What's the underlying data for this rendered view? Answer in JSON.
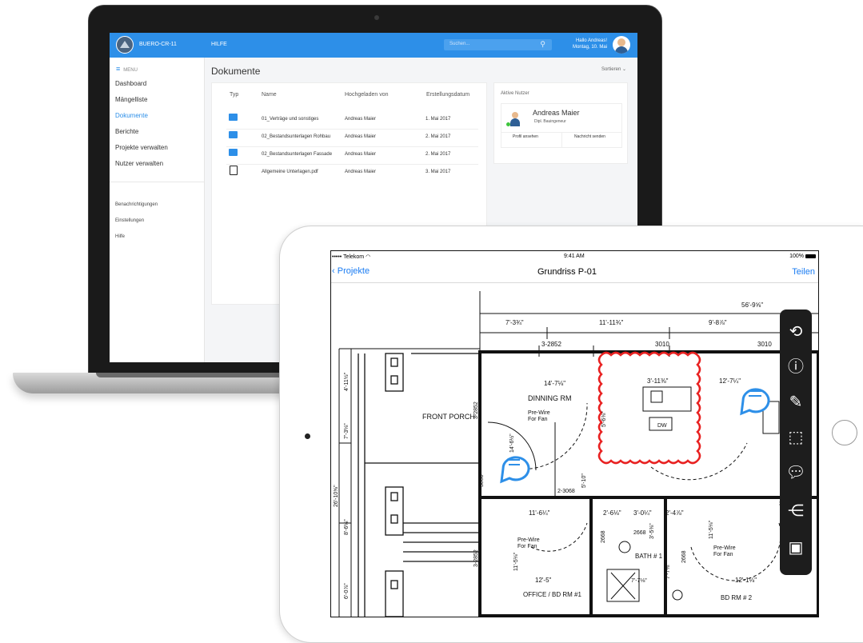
{
  "laptop": {
    "app_name": "BUERO-CR-11",
    "help_label": "HILFE",
    "search_placeholder": "Suchen...",
    "greeting": "Hallo Andreas!",
    "date": "Montag, 10. Mai",
    "menu_label": "MENU",
    "nav": [
      {
        "label": "Dashboard"
      },
      {
        "label": "Mängelliste"
      },
      {
        "label": "Dokumente",
        "active": true
      },
      {
        "label": "Berichte"
      },
      {
        "label": "Projekte verwalten"
      },
      {
        "label": "Nutzer verwalten"
      }
    ],
    "nav_secondary": [
      {
        "label": "Benachrichtigungen"
      },
      {
        "label": "Einstellungen"
      },
      {
        "label": "Hilfe"
      }
    ],
    "page_title": "Dokumente",
    "sort_label": "Sortieren",
    "table": {
      "headers": [
        "Typ",
        "Name",
        "Hochgeladen von",
        "Erstellungsdatum"
      ],
      "rows": [
        {
          "type": "folder",
          "name": "01_Verträge und sonstiges",
          "uploader": "Andreas Maier",
          "date": "1. Mai 2017"
        },
        {
          "type": "folder",
          "name": "02_Bestandsunterlagen Rohbau",
          "uploader": "Andreas Maier",
          "date": "2. Mai 2017"
        },
        {
          "type": "folder",
          "name": "02_Bestandsunterlagen Fassade",
          "uploader": "Andreas Maier",
          "date": "2. Mai 2017"
        },
        {
          "type": "pdf",
          "name": "Allgemeine Unterlagen.pdf",
          "uploader": "Andreas Maier",
          "date": "3. Mai 2017"
        }
      ]
    },
    "active_users": {
      "heading": "Aktive Nutzer",
      "name": "Andreas Maier",
      "role": "Dipl. Bauingeneur",
      "profile_button": "Profil ansehen",
      "message_button": "Nachricht senden"
    },
    "accent_color": "#2d8fe8"
  },
  "ipad": {
    "carrier": "••••• Telekom",
    "time": "9:41 AM",
    "battery": "100%",
    "back_label": "Projekte",
    "title": "Grundriss P-01",
    "share_label": "Teilen",
    "toolbar_icons": [
      "lasso-select-icon",
      "info-icon",
      "pencil-icon",
      "rectangle-select-icon",
      "comment-icon",
      "share-icon",
      "save-icon"
    ],
    "plan_labels": {
      "dim_total": "56'-9⅝\"",
      "dim_a": "7'-3¾\"",
      "dim_b": "11'-11¾\"",
      "dim_c": "9'-8⅞\"",
      "win_a": "3-2852",
      "win_b": "3010",
      "win_c": "3010",
      "dining_dim": "14'-7⅛\"",
      "dining": "DINNING RM",
      "prewire_1": "Pre-Wire",
      "prewire_1b": "For Fan",
      "front_porch": "FRONT PORCH",
      "vert_a": "3-2852",
      "vert_b": "14'-6½\"",
      "left_a": "4'-11½\"",
      "left_b": "7'-3⅛\"",
      "left_c": "26'-10⅝\"",
      "left_d": "8'-6⅛\"",
      "left_e": "6'-0⅞\"",
      "door_a": "3068",
      "kitchen_a": "3'-11⅜\"",
      "kitchen_b": "12'-7¼\"",
      "kitchen_v": "5'-6⅜\"",
      "dw": "DW",
      "mid_v": "5'-10\"",
      "hall_a": "2-3068",
      "hall_b": "11'-6¼\"",
      "hall_c": "2'-6⅛\"",
      "hall_d": "3'-0¼\"",
      "hall_e": "2'-4⅞\"",
      "d2668_a": "2668",
      "d2668_b": "2668",
      "d2668_c": "2668",
      "v_35": "3'-5⅜\"",
      "v_115": "11'-5⅛\"",
      "prewire_2": "Pre-Wire",
      "prewire_2b": "For Fan",
      "prewire_3": "Pre-Wire",
      "prewire_3b": "For Fan",
      "v_2852": "3-2852",
      "v_115b": "11'-5⅛\"",
      "bath": "BATH # 1",
      "v_77": "7'-7⅛\"",
      "office_dim": "12'-5\"",
      "office": "OFFICE / BD RM #1",
      "d_77": "7'-7⅛\"",
      "bd2_dim": "12'-1⅛\"",
      "bd2": "BD RM # 2",
      "r3068": "3068"
    },
    "markup_color": "#e82121",
    "comment_color": "#2d8fe8"
  }
}
